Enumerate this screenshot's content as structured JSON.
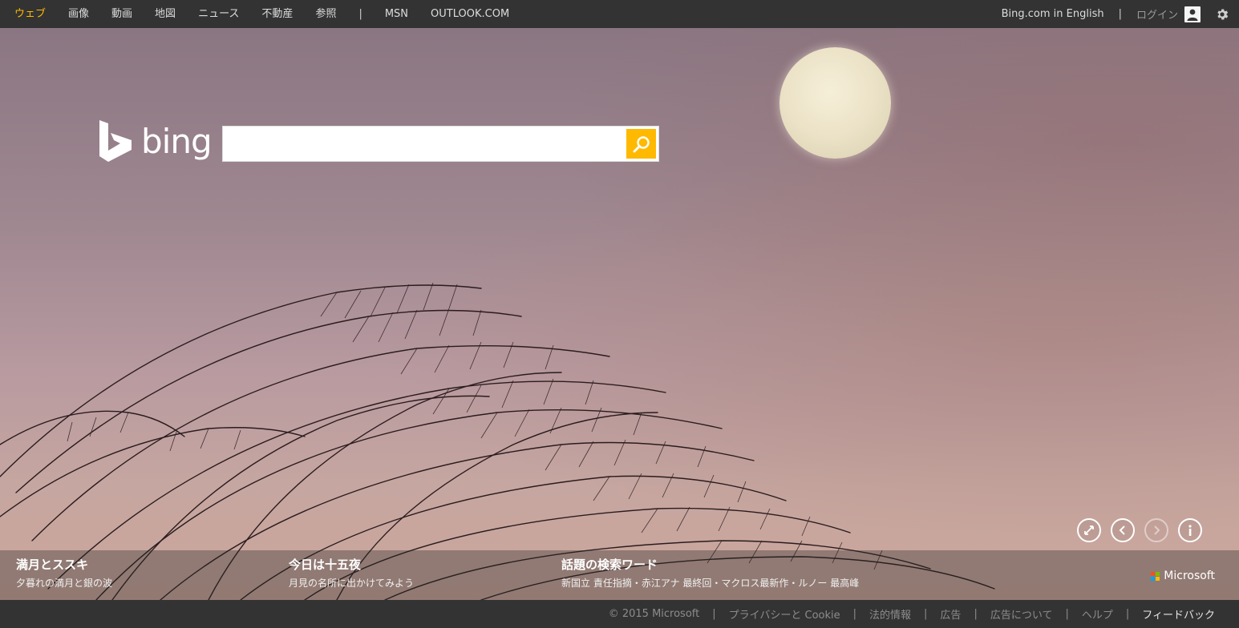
{
  "topbar": {
    "nav": [
      {
        "label": "ウェブ",
        "active": true
      },
      {
        "label": "画像"
      },
      {
        "label": "動画"
      },
      {
        "label": "地図"
      },
      {
        "label": "ニュース"
      },
      {
        "label": "不動産"
      },
      {
        "label": "参照"
      }
    ],
    "separator": "|",
    "extra": [
      {
        "label": "MSN"
      },
      {
        "label": "OUTLOOK.COM"
      }
    ],
    "english_link": "Bing.com in English",
    "right_separator": "|",
    "login_label": "ログイン",
    "icons": {
      "avatar": "user-icon",
      "settings": "gear-icon"
    }
  },
  "logo": {
    "text": "bing"
  },
  "search": {
    "value": "",
    "placeholder": "",
    "button_icon": "search-icon"
  },
  "controls": [
    "fullscreen-icon",
    "previous-icon",
    "next-icon",
    "info-icon"
  ],
  "captions": [
    {
      "title": "満月とススキ",
      "subtitle": "夕暮れの満月と銀の波"
    },
    {
      "title": "今日は十五夜",
      "subtitle": "月見の名所に出かけてみよう"
    },
    {
      "title": "話題の検索ワード",
      "subtitle": "新国立 責任指摘・赤江アナ 最終回・マクロス最新作・ルノー 最高峰"
    }
  ],
  "microsoft_logo": {
    "text": "Microsoft"
  },
  "footer": {
    "items": [
      {
        "label": "© 2015 Microsoft"
      },
      {
        "label": "プライバシーと Cookie"
      },
      {
        "label": "法的情報"
      },
      {
        "label": "広告"
      },
      {
        "label": "広告について"
      },
      {
        "label": "ヘルプ"
      },
      {
        "label": "フィードバック"
      }
    ],
    "separator": "|"
  },
  "colors": {
    "accent": "#ffb900",
    "bar_background": "#333333",
    "microsoft_squares": [
      "#f25022",
      "#7fba00",
      "#00a4ef",
      "#ffb900"
    ]
  }
}
